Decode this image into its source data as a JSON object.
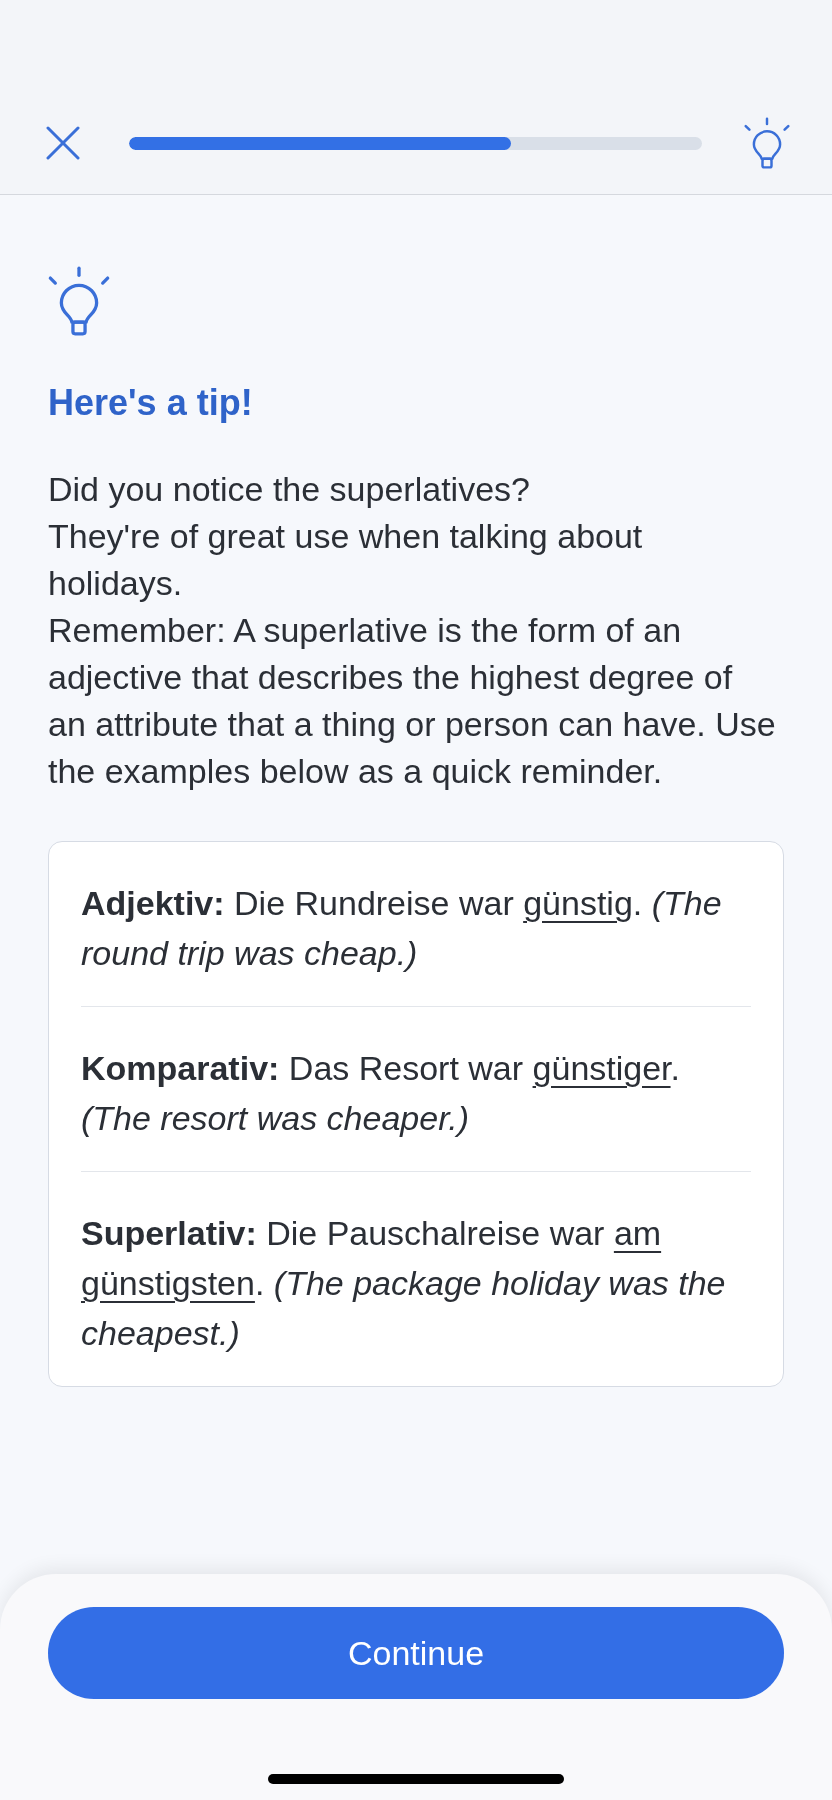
{
  "progress": {
    "level": 0.667
  },
  "tip": {
    "title": "Here's a tip!",
    "paragraphs": [
      "Did you notice the superlatives?",
      "They're of great use when talking about holidays.",
      "Remember: A superlative is the form of an adjective that describes the highest degree of an attribute that a thing or person can have. Use the examples below as a quick reminder."
    ]
  },
  "examples": [
    {
      "segments": [
        {
          "text": "**Adjektiv:** Die Rundreise war ",
          "underlined": false
        },
        {
          "text": "günstig",
          "underlined": true
        },
        {
          "text": ". *(The round trip was cheap.)*",
          "underlined": false
        }
      ]
    },
    {
      "segments": [
        {
          "text": "**Komparativ:** Das Resort war ",
          "underlined": false
        },
        {
          "text": "günstiger",
          "underlined": true
        },
        {
          "text": ". *(The resort was cheaper.)*",
          "underlined": false
        }
      ]
    },
    {
      "segments": [
        {
          "text": "**Superlativ:** Die Pauschalreise war ",
          "underlined": false
        },
        {
          "text": "am günstigsten",
          "underlined": true
        },
        {
          "text": ". *(The package holiday was the cheapest.)*",
          "underlined": false
        }
      ]
    }
  ],
  "continue_button": {
    "label": "Continue"
  }
}
